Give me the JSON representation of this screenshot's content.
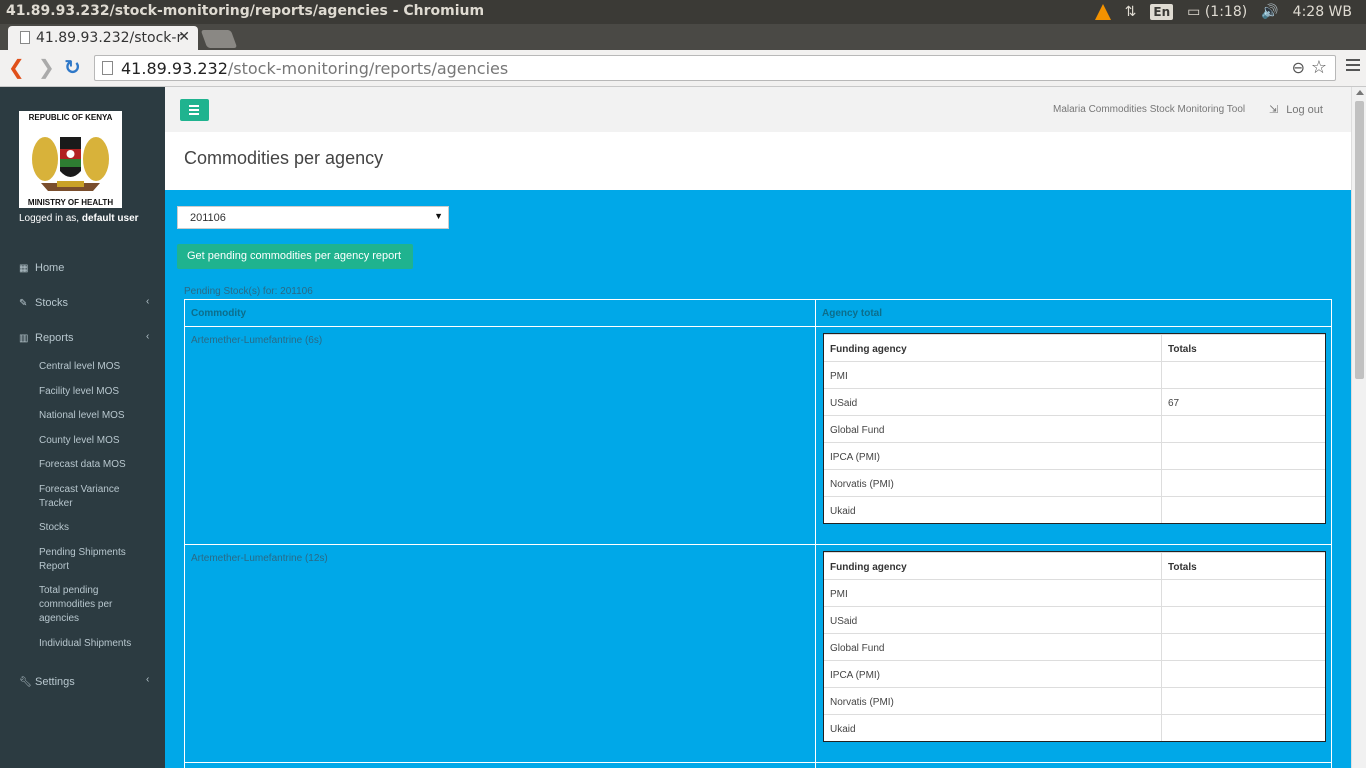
{
  "os": {
    "window_title": "41.89.93.232/stock-monitoring/reports/agencies - Chromium",
    "keyboard": "En",
    "battery": "(1:18)",
    "clock": "4:28 WB"
  },
  "browser": {
    "tab_title": "41.89.93.232/stock-r",
    "url_host": "41.89.93.232",
    "url_path": "/stock-monitoring/reports/agencies"
  },
  "sidebar": {
    "logo_top": "REPUBLIC OF KENYA",
    "logo_bottom": "MINISTRY OF HEALTH",
    "logged_prefix": "Logged in as,",
    "logged_user": "default user",
    "items": [
      {
        "label": "Home",
        "icon": "dashboard-icon"
      },
      {
        "label": "Stocks",
        "icon": "edit-icon"
      },
      {
        "label": "Reports",
        "icon": "bar-chart-icon"
      },
      {
        "label": "Settings",
        "icon": "wrench-icon"
      }
    ],
    "report_links": [
      "Central level MOS",
      "Facility level MOS",
      "National level MOS",
      "County level MOS",
      "Forecast data MOS",
      "Forecast Variance Tracker",
      "Stocks",
      "Pending Shipments Report",
      "Total pending commodities per agencies",
      "Individual Shipments"
    ]
  },
  "topnav": {
    "app_name": "Malaria Commodities Stock Monitoring Tool",
    "logout": "Log out"
  },
  "page": {
    "title": "Commodities per agency",
    "period_value": "201106",
    "get_button": "Get pending commodities per agency report",
    "caption": "Pending Stock(s) for: 201106",
    "col_commodity": "Commodity",
    "col_agency_total": "Agency total",
    "sub_head_agency": "Funding agency",
    "sub_head_totals": "Totals",
    "rows": [
      {
        "commodity": "Artemether-Lumefantrine (6s)",
        "agencies": [
          {
            "name": "PMI",
            "total": ""
          },
          {
            "name": "USaid",
            "total": "67"
          },
          {
            "name": "Global Fund",
            "total": ""
          },
          {
            "name": "IPCA (PMI)",
            "total": ""
          },
          {
            "name": "Norvatis (PMI)",
            "total": ""
          },
          {
            "name": "Ukaid",
            "total": ""
          }
        ]
      },
      {
        "commodity": "Artemether-Lumefantrine (12s)",
        "agencies": [
          {
            "name": "PMI",
            "total": ""
          },
          {
            "name": "USaid",
            "total": ""
          },
          {
            "name": "Global Fund",
            "total": ""
          },
          {
            "name": "IPCA (PMI)",
            "total": ""
          },
          {
            "name": "Norvatis (PMI)",
            "total": ""
          },
          {
            "name": "Ukaid",
            "total": ""
          }
        ]
      }
    ]
  }
}
